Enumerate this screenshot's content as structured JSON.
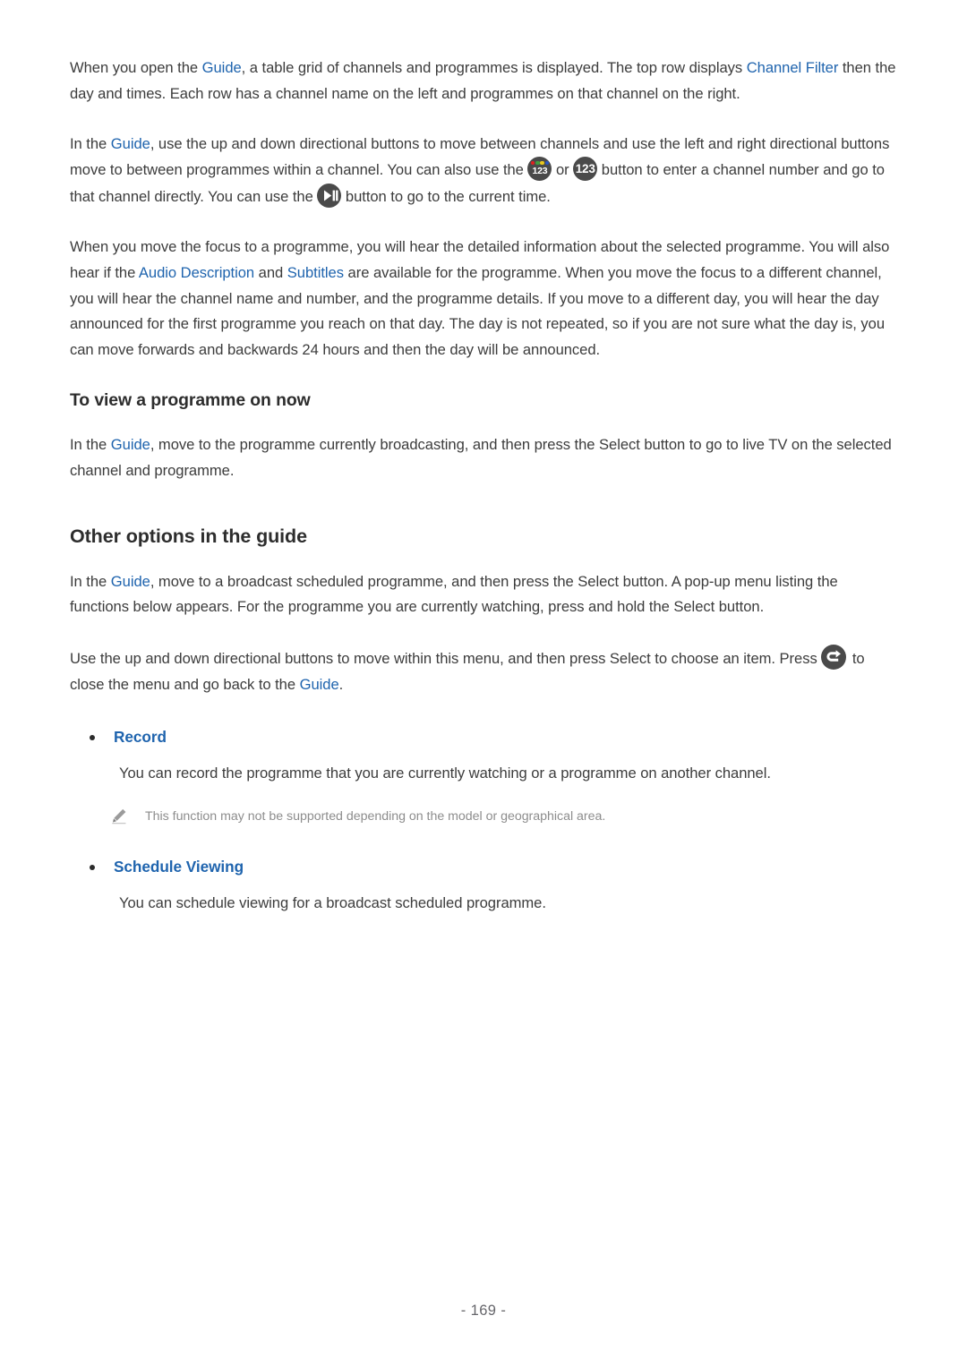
{
  "document": {
    "page_number": "- 169 -"
  },
  "paragraphs": {
    "p1": {
      "seg1": "When you open the ",
      "link1": "Guide",
      "seg2": ", a table grid of channels and programmes is displayed. The top row displays ",
      "link2": "Channel Filter",
      "seg3": " then the day and times. Each row has a channel name on the left and programmes on that channel on the right."
    },
    "p2": {
      "seg1": "In the ",
      "link1": "Guide",
      "seg2": ", use the up and down directional buttons to move between channels and use the left and right directional buttons move to between programmes within a channel. You can also use the ",
      "icon1": "123-color-button-icon",
      "seg3": " or ",
      "icon2": "123-button-icon",
      "seg4": " button to enter a channel number and go to that channel directly. You can use the ",
      "icon3": "play-pause-button-icon",
      "seg5": " button to go to the current time."
    },
    "p3": {
      "seg1": "When you move the focus to a programme, you will hear the detailed information about the selected programme. You will also hear if the ",
      "link1": "Audio Description",
      "seg2": " and ",
      "link2": "Subtitles",
      "seg3": " are available for the programme. When you move the focus to a different channel, you will hear the channel name and number, and the programme details. If you move to a different day, you will hear the day announced for the first programme you reach on that day. The day is not repeated, so if you are not sure what the day is, you can move forwards and backwards 24 hours and then the day will be announced."
    },
    "p4": {
      "seg1": "In the ",
      "link1": "Guide",
      "seg2": ", move to the programme currently broadcasting, and then press the Select button to go to live TV on the selected channel and programme."
    },
    "p5": {
      "seg1": "In the ",
      "link1": "Guide",
      "seg2": ", move to a broadcast scheduled programme, and then press the Select button. A pop-up menu listing the functions below appears. For the programme you are currently watching, press and hold the Select button."
    },
    "p6": {
      "seg1": "Use the up and down directional buttons to move within this menu, and then press Select to choose an item. Press ",
      "icon1": "return-button-icon",
      "seg2": " to close the menu and go back to the ",
      "link1": "Guide",
      "seg3": "."
    }
  },
  "headings": {
    "h1": "To view a programme on now",
    "h2": "Other options in the guide"
  },
  "options_list": [
    {
      "label": "Record",
      "description": "You can record the programme that you are currently watching or a programme on another channel.",
      "note": "This function may not be supported depending on the model or geographical area."
    },
    {
      "label": "Schedule Viewing",
      "description": "You can schedule viewing for a broadcast scheduled programme."
    }
  ],
  "colors": {
    "link_blue": "#1f64ae",
    "body_text": "#3c3c3c",
    "heading_text": "#2d2d2d",
    "note_text": "#8d8d8d",
    "icon_circle": "#4a4a4a",
    "dot_red": "#e02020",
    "dot_green": "#3fa03f",
    "dot_yellow": "#e8c81e",
    "dot_blue": "#2a56c6"
  }
}
